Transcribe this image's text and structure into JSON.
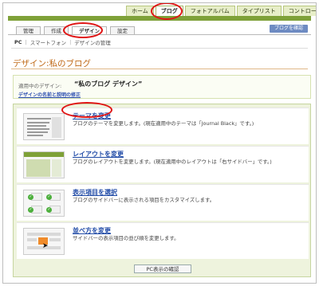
{
  "top_tabs": [
    "ホーム",
    "ブログ",
    "フォトアルバム",
    "タイプリスト",
    "コントロールパネル"
  ],
  "top_active": "ブログ",
  "sub_tabs": [
    "管理",
    "作成",
    "デザイン",
    "設定"
  ],
  "blog_confirm_label": "ブログを確認",
  "breadcrumb": {
    "current": "PC",
    "items": [
      "スマートフォン",
      "デザインの管理"
    ]
  },
  "page_title": "デザイン:私のブログ",
  "current_design": {
    "label": "適用中のデザイン:",
    "value": "“私のブログ デザイン”",
    "link": "デザインの名前と説明の修正"
  },
  "options": [
    {
      "title": "テーマを変更",
      "desc": "ブログのテーマを変更します。(現在適用中のテーマは「Journal Black」です。)"
    },
    {
      "title": "レイアウトを変更",
      "desc": "ブログのレイアウトを変更します。(現在適用中のレイアウトは「右サイドバー」です。)"
    },
    {
      "title": "表示項目を選択",
      "desc": "ブログのサイドバーに表示される項目をカスタマイズします。"
    },
    {
      "title": "並べ方を変更",
      "desc": "サイドバーの表示項目の並び順を変更します。"
    }
  ],
  "pc_confirm_label": "PC表示の確認",
  "colors": {
    "accent_green": "#7ea138",
    "title_orange": "#c06a18",
    "link_blue": "#1f4aa6",
    "highlight_red": "#e01515"
  },
  "icons": [
    "check-icon",
    "cursor-arrow-icon"
  ]
}
